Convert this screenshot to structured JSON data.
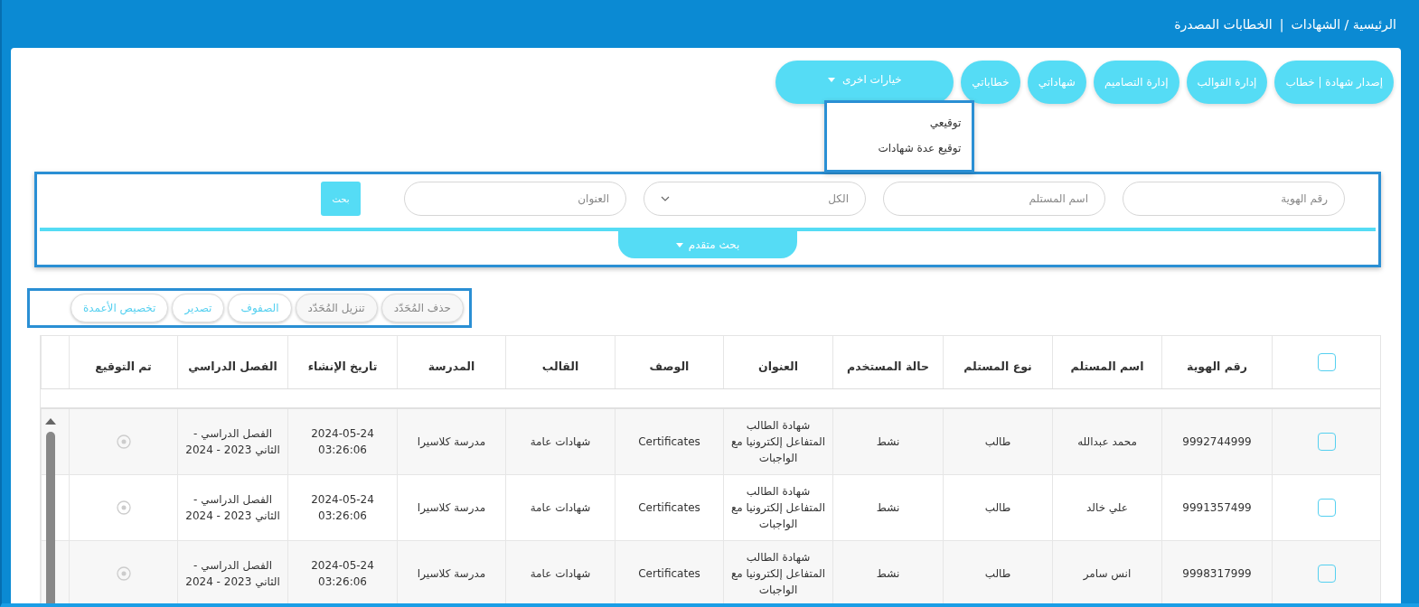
{
  "header": {
    "breadcrumb": [
      "الرئيسية / الشهادات"
    ],
    "separator": "|",
    "title": "الخطابات المصدرة"
  },
  "nav_buttons": [
    {
      "label": "إصدار شهادة | خطاب",
      "kind": "button"
    },
    {
      "label": "إدارة القوالب",
      "kind": "button"
    },
    {
      "label": "إدارة التصاميم",
      "kind": "button"
    },
    {
      "label": "شهاداتي",
      "kind": "button"
    },
    {
      "label": "خطاباتي",
      "kind": "button"
    },
    {
      "label": "خيارات اخرى",
      "kind": "dropdown",
      "expanded": true
    }
  ],
  "dropdown_menu": {
    "items": [
      "توقيعي",
      "توقيع عدة شهادات"
    ]
  },
  "search": {
    "fields": [
      {
        "kind": "input",
        "placeholder": "رقم الهوية"
      },
      {
        "kind": "input",
        "placeholder": "اسم المستلم"
      },
      {
        "kind": "select",
        "value": "الكل"
      },
      {
        "kind": "input",
        "placeholder": "العنوان"
      }
    ],
    "button": "بحث",
    "advanced": "بحث متقدم"
  },
  "toolbar": [
    {
      "label": "حذف المُحَدّد",
      "disabled": true
    },
    {
      "label": "تنزيل المُحَدّد",
      "disabled": true
    },
    {
      "label": "الصفوف",
      "disabled": false
    },
    {
      "label": "تصدير",
      "disabled": false
    },
    {
      "label": "تخصيص الأعمدة",
      "disabled": false
    }
  ],
  "table": {
    "select_all": {
      "checked": false
    },
    "columns": [
      "رقم الهوية",
      "اسم المستلم",
      "نوع المستلم",
      "حالة المستخدم",
      "العنوان",
      "الوصف",
      "القالب",
      "المدرسة",
      "تاريخ الإنشاء",
      "الفصل الدراسي",
      "تم التوقيع"
    ],
    "rows": [
      {
        "selected": false,
        "cells": [
          "9992744999",
          "محمد عبدالله",
          "طالب",
          "نشط",
          "شهادة الطالب المتفاعل إلكترونيا مع الواجبات",
          "Certificates",
          "شهادات عامة",
          "مدرسة كلاسيرا",
          "2024-05-24 03:26:06",
          "الفصل الدراسي - الثاني 2023 - 2024"
        ]
      },
      {
        "selected": false,
        "cells": [
          "9991357499",
          "علي خالد",
          "طالب",
          "نشط",
          "شهادة الطالب المتفاعل إلكترونيا مع الواجبات",
          "Certificates",
          "شهادات عامة",
          "مدرسة كلاسيرا",
          "2024-05-24 03:26:06",
          "الفصل الدراسي - الثاني 2023 - 2024"
        ]
      },
      {
        "selected": false,
        "cells": [
          "9998317999",
          "انس سامر",
          "طالب",
          "نشط",
          "شهادة الطالب المتفاعل إلكترونيا مع الواجبات",
          "Certificates",
          "شهادات عامة",
          "مدرسة كلاسيرا",
          "2024-05-24 03:26:06",
          "الفصل الدراسي - الثاني 2023 - 2024"
        ]
      }
    ]
  }
}
